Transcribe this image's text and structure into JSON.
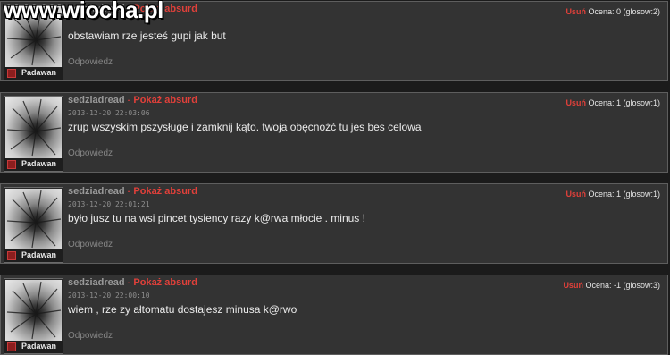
{
  "watermark": "www.wiocha.pl",
  "comments": [
    {
      "author": "sedziadread",
      "separator": "-",
      "absurd_label": "Pokaż absurd",
      "date": "",
      "text": "obstawiam rze jesteś gupi jak but",
      "reply": "Odpowiedz",
      "delete": "Usuń",
      "rating": "Ocena: 0 (glosow:2)",
      "rank": "Padawan"
    },
    {
      "author": "sedziadread",
      "separator": "-",
      "absurd_label": "Pokaż absurd",
      "date": "2013-12-20 22:03:06",
      "text": "zrup wszyskim pszysługe i zamknij kąto. twoja obęcnożć tu jes bes celowa",
      "reply": "Odpowiedz",
      "delete": "Usuń",
      "rating": "Ocena: 1 (glosow:1)",
      "rank": "Padawan"
    },
    {
      "author": "sedziadread",
      "separator": "-",
      "absurd_label": "Pokaż absurd",
      "date": "2013-12-20 22:01:21",
      "text": "było jusz tu na wsi pincet tysiency razy k@rwa młocie . minus !",
      "reply": "Odpowiedz",
      "delete": "Usuń",
      "rating": "Ocena: 1 (glosow:1)",
      "rank": "Padawan"
    },
    {
      "author": "sedziadread",
      "separator": "-",
      "absurd_label": "Pokaż absurd",
      "date": "2013-12-20 22:00:10",
      "text": "wiem , rze zy ałtomatu dostajesz minusa k@rwo",
      "reply": "Odpowiedz",
      "delete": "Usuń",
      "rating": "Ocena: -1 (glosow:3)",
      "rank": "Padawan"
    }
  ],
  "colors": {
    "background": "#1b1b1b",
    "card": "#333333",
    "accent_red": "#e0403a"
  },
  "icons": [
    "avatar-image",
    "rank-badge-icon"
  ]
}
